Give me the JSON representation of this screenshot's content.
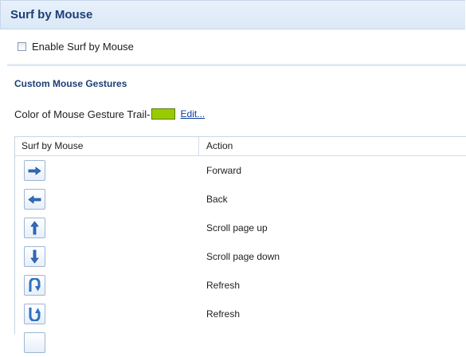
{
  "header": {
    "title": "Surf by Mouse"
  },
  "enable": {
    "label": "Enable Surf by Mouse",
    "checked": false
  },
  "section": {
    "title": "Custom Mouse Gestures"
  },
  "trail": {
    "label": "Color of Mouse Gesture Trail-",
    "color": "#99cc00",
    "edit_label": "Edit..."
  },
  "table": {
    "columns": [
      "Surf by Mouse",
      "Action"
    ],
    "rows": [
      {
        "icon": "arrow-right-icon",
        "action": "Forward"
      },
      {
        "icon": "arrow-left-icon",
        "action": "Back"
      },
      {
        "icon": "arrow-up-icon",
        "action": "Scroll page up"
      },
      {
        "icon": "arrow-down-icon",
        "action": "Scroll page down"
      },
      {
        "icon": "u-turn-down-icon",
        "action": "Refresh"
      },
      {
        "icon": "u-turn-up-icon",
        "action": "Refresh"
      }
    ]
  },
  "colors": {
    "header_title": "#1c3f78",
    "icon_arrow": "#2f6fbf",
    "link": "#0a3c9c"
  }
}
